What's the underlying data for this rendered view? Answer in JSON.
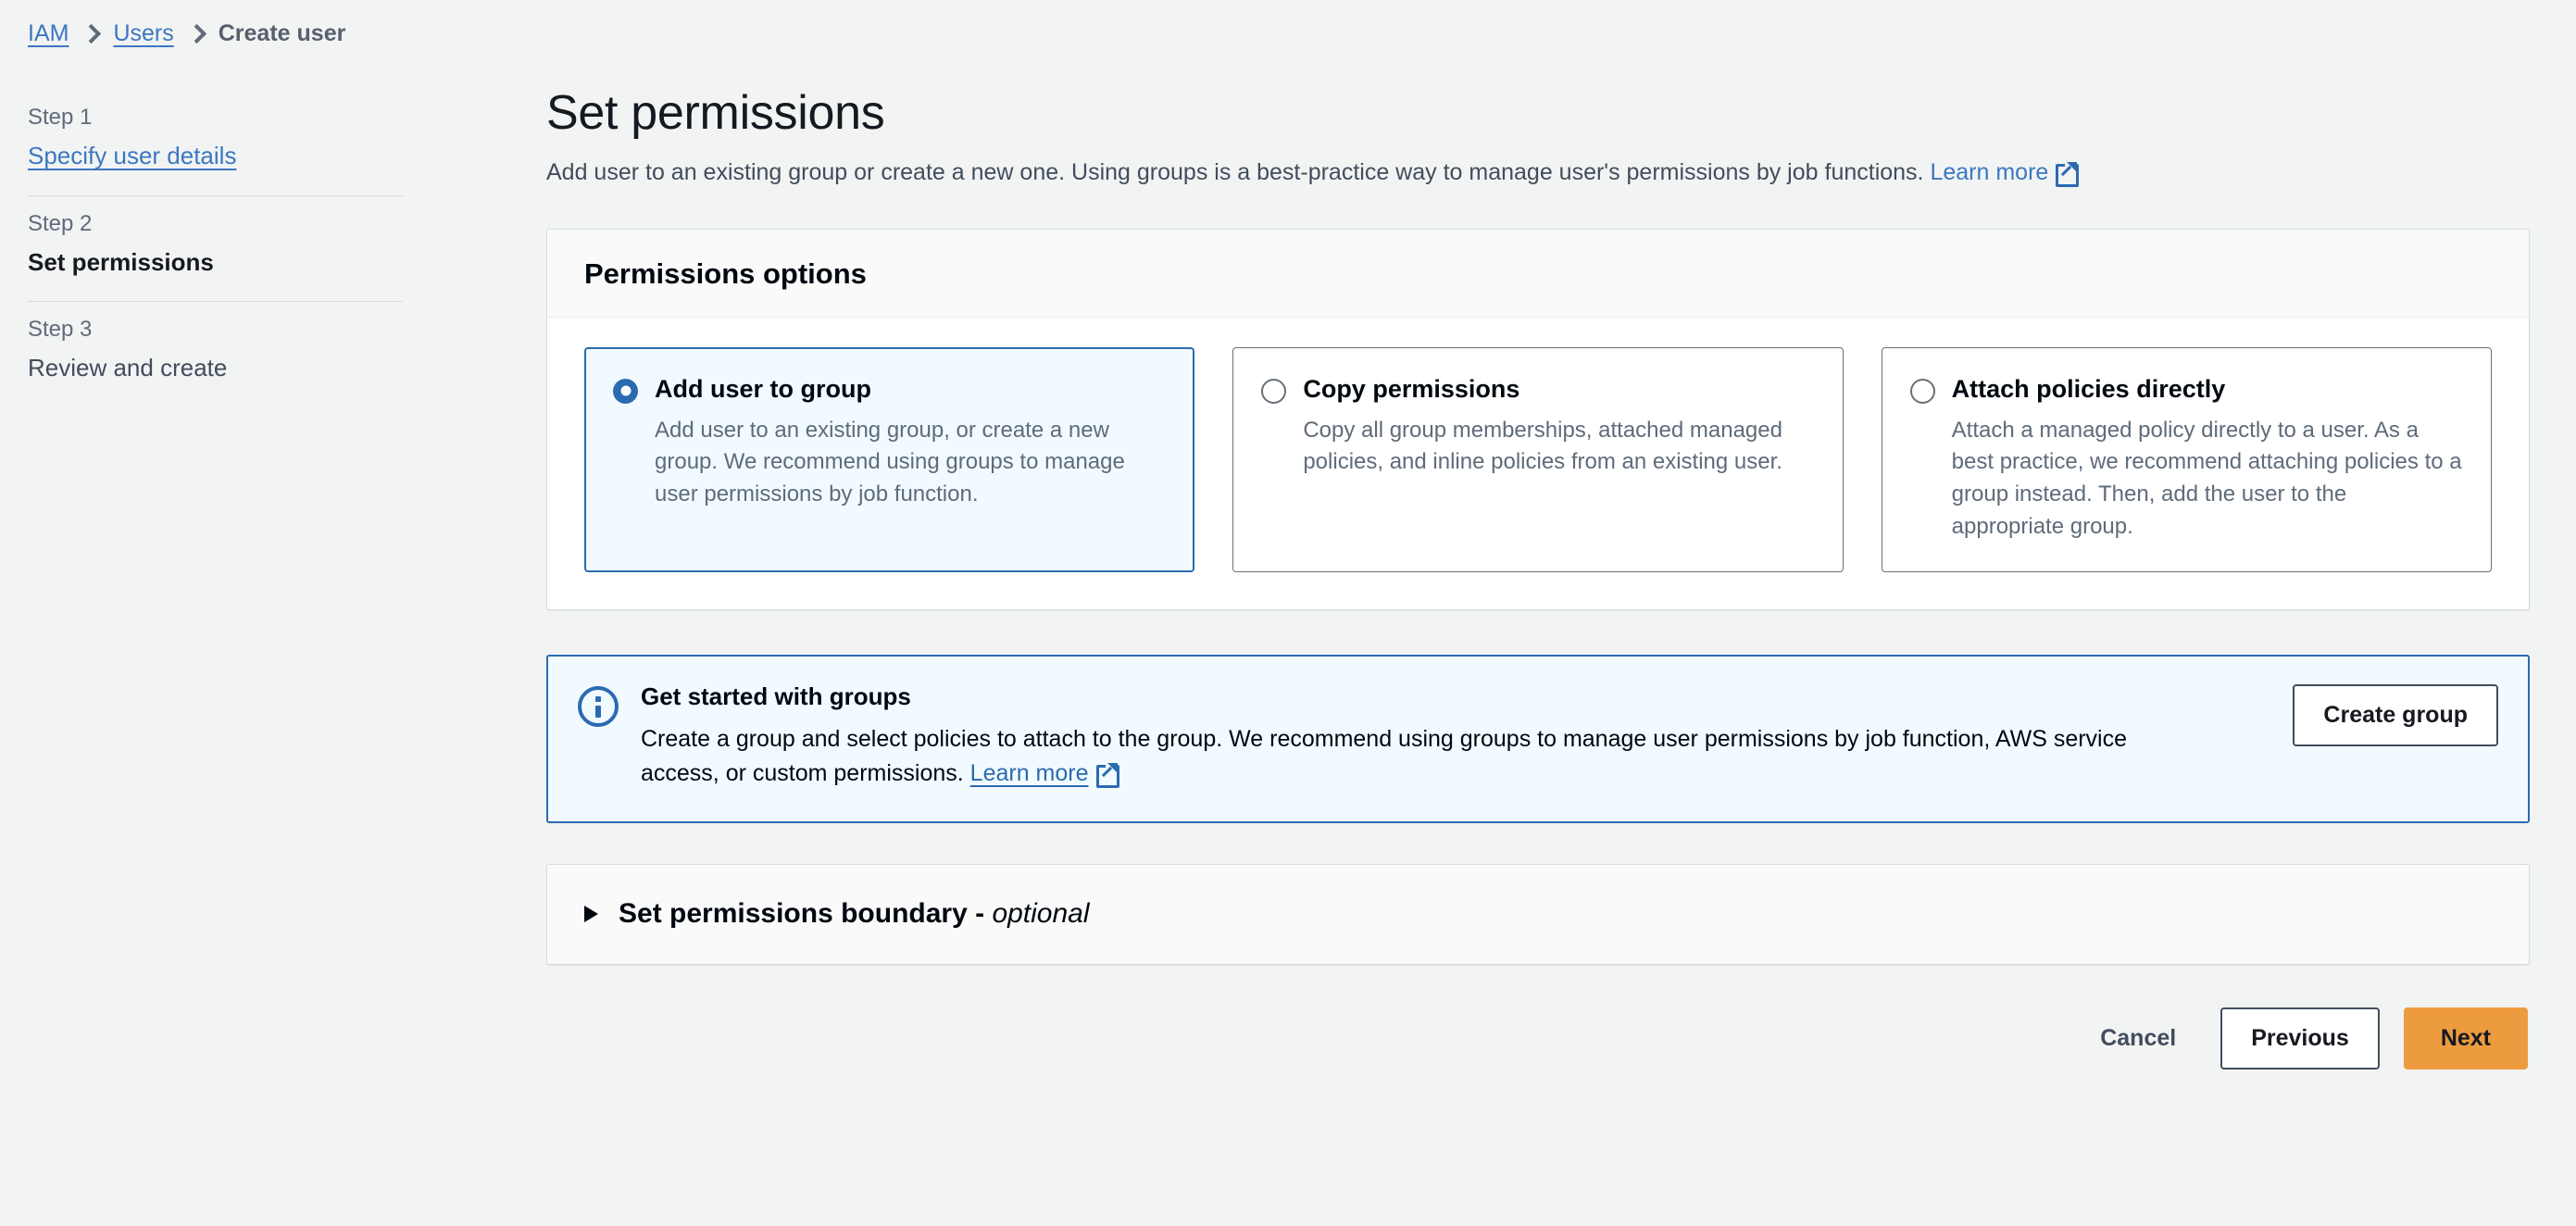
{
  "breadcrumb": {
    "items": [
      {
        "label": "IAM",
        "type": "link"
      },
      {
        "label": "Users",
        "type": "link"
      },
      {
        "label": "Create user",
        "type": "current"
      }
    ]
  },
  "wizard": {
    "steps": [
      {
        "number": "Step 1",
        "name": "Specify user details",
        "state": "link"
      },
      {
        "number": "Step 2",
        "name": "Set permissions",
        "state": "active"
      },
      {
        "number": "Step 3",
        "name": "Review and create",
        "state": "plain"
      }
    ]
  },
  "page": {
    "title": "Set permissions",
    "description": "Add user to an existing group or create a new one. Using groups is a best-practice way to manage user's permissions by job functions.",
    "learn_more": "Learn more"
  },
  "permissions_panel": {
    "header": "Permissions options",
    "options": [
      {
        "label": "Add user to group",
        "description": "Add user to an existing group, or create a new group. We recommend using groups to manage user permissions by job function.",
        "selected": true
      },
      {
        "label": "Copy permissions",
        "description": "Copy all group memberships, attached managed policies, and inline policies from an existing user.",
        "selected": false
      },
      {
        "label": "Attach policies directly",
        "description": "Attach a managed policy directly to a user. As a best practice, we recommend attaching policies to a group instead. Then, add the user to the appropriate group.",
        "selected": false
      }
    ]
  },
  "alert": {
    "title": "Get started with groups",
    "body": "Create a group and select policies to attach to the group. We recommend using groups to manage user permissions by job function, AWS service access, or custom permissions.",
    "learn_more": "Learn more",
    "button": "Create group"
  },
  "permissions_boundary": {
    "title": "Set permissions boundary -",
    "optional": "optional"
  },
  "actions": {
    "cancel": "Cancel",
    "previous": "Previous",
    "next": "Next"
  },
  "colors": {
    "page_background": "#f2f3f3",
    "link": "#3b77c0",
    "accent_blue": "#2b6bb0",
    "selected_card_background": "#f1faff",
    "primary_button": "#ec9b3f",
    "border": "#d5dbdb"
  }
}
